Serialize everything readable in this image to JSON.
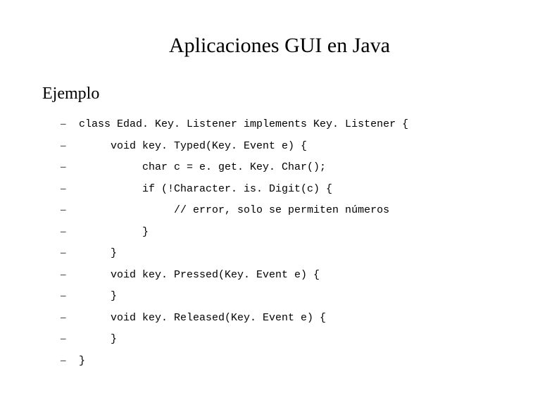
{
  "title": "Aplicaciones GUI en Java",
  "subtitle": "Ejemplo",
  "code": {
    "lines": [
      "class Edad. Key. Listener implements Key. Listener {",
      "     void key. Typed(Key. Event e) {",
      "          char c = e. get. Key. Char();",
      "          if (!Character. is. Digit(c) {",
      "               // error, solo se permiten números",
      "          }",
      "     }",
      "     void key. Pressed(Key. Event e) {",
      "     }",
      "     void key. Released(Key. Event e) {",
      "     }",
      "}"
    ]
  }
}
